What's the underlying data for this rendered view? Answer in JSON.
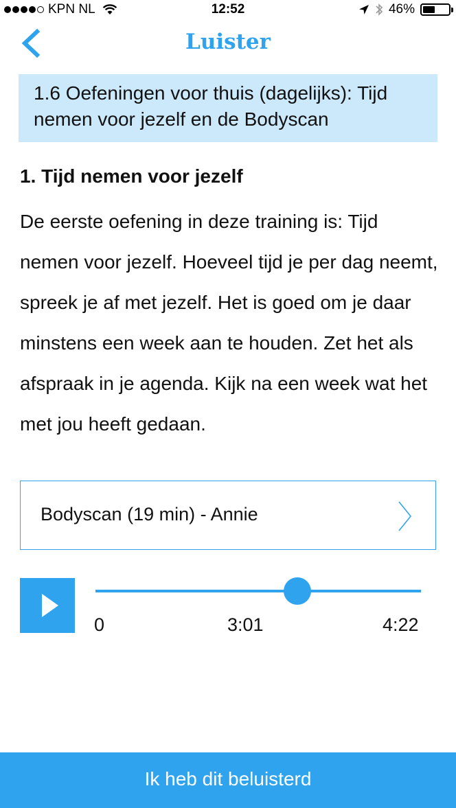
{
  "status_bar": {
    "carrier": "KPN NL",
    "time": "12:52",
    "battery_percent": "46%",
    "battery_level": 0.46,
    "signal_bars_filled": 4,
    "signal_bars_total": 5
  },
  "nav": {
    "title": "Luister",
    "back_icon": "chevron-left-icon"
  },
  "lesson": {
    "title": "1.6 Oefeningen voor thuis (dagelijks): Tijd nemen voor jezelf en de Bodyscan"
  },
  "section": {
    "heading": "1. Tijd nemen voor jezelf",
    "body": "De eerste oefening in deze training is: Tijd nemen voor jezelf. Hoeveel tijd je per dag neemt, spreek je af met jezelf. Het is goed om je daar minstens een week aan te houden. Zet het als afspraak in je agenda. Kijk na een week wat het met jou heeft gedaan."
  },
  "audio": {
    "selected_track": "Bodyscan (19 min) - Annie",
    "chevron_icon": "chevron-right-icon",
    "play_icon": "play-icon",
    "time_start": "0",
    "time_current": "3:01",
    "time_end": "4:22",
    "progress_fraction": 0.62
  },
  "cta": {
    "label": "Ik heb dit beluisterd"
  },
  "colors": {
    "accent": "#2fa3ee",
    "banner_bg": "#cce8fb",
    "text": "#111111"
  }
}
